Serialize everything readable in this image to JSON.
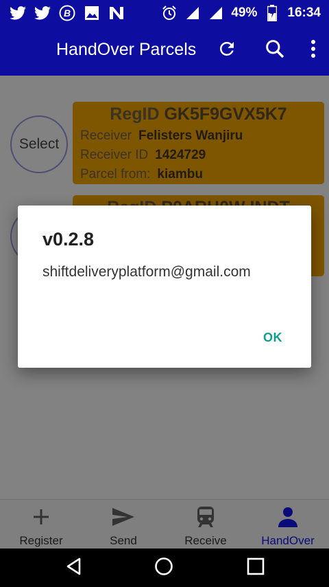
{
  "status_bar": {
    "battery": "49%",
    "time": "16:34",
    "left_icons": [
      "twitter-icon",
      "twitter-icon",
      "bitcoin-icon",
      "image-icon",
      "n-logo-icon"
    ],
    "right_icons": [
      "alarm-icon",
      "signal-icon",
      "signal-icon",
      "battery-icon"
    ]
  },
  "app_bar": {
    "title": "HandOver Parcels",
    "actions": [
      "refresh-icon",
      "search-icon",
      "more-vert-icon"
    ]
  },
  "parcels": [
    {
      "select_label": "Select",
      "regid_label": "RegID",
      "regid": "GK5F9GVX5K7",
      "receiver_label": "Receiver",
      "receiver": "Felisters Wanjiru",
      "receiver_id_label": "Receiver ID",
      "receiver_id": "1424729",
      "from_label": "Parcel from:",
      "from": "kiambu"
    },
    {
      "regid_label": "RegID",
      "regid": "P0ARH0W INDT"
    }
  ],
  "dialog": {
    "title": "v0.2.8",
    "message": "shiftdeliveryplatform@gmail.com",
    "ok_label": "OK"
  },
  "bottom_nav": {
    "items": [
      {
        "label": "Register",
        "icon": "plus-icon"
      },
      {
        "label": "Send",
        "icon": "send-icon"
      },
      {
        "label": "Receive",
        "icon": "train-icon"
      },
      {
        "label": "HandOver",
        "icon": "person-icon",
        "active": true
      }
    ]
  },
  "colors": {
    "primary": "#0d0da0",
    "card": "#e59d00",
    "accent_ok": "#0f9e8c"
  }
}
